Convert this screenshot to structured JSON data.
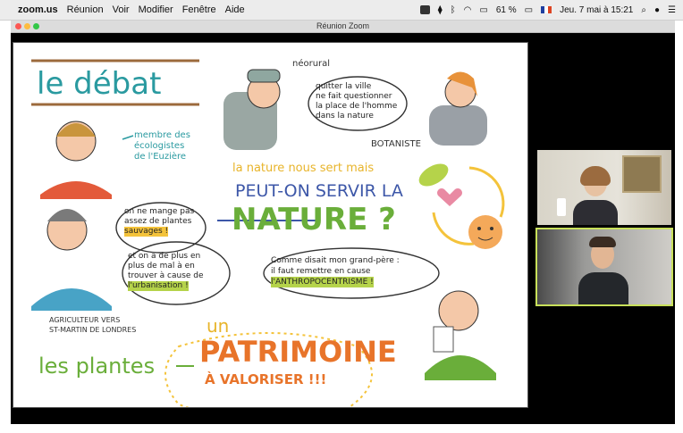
{
  "menubar": {
    "app": "zoom.us",
    "items": [
      "Réunion",
      "Voir",
      "Modifier",
      "Fenêtre",
      "Aide"
    ],
    "battery": "61 %",
    "datetime": "Jeu. 7 mai à 15:21"
  },
  "window": {
    "title": "Réunion Zoom"
  },
  "board": {
    "title": "le débat",
    "neorural_label": "néorural",
    "neorural_quote": [
      "quitter la ville",
      "ne fait questionner",
      "la place de l'homme",
      "dans la nature"
    ],
    "botanist_label": "BOTANISTE",
    "ecologist_caption": [
      "membre des",
      "écologistes",
      "de l'Euzière"
    ],
    "main_line1": "la nature nous sert mais",
    "main_line2": "PEUT-ON SERVIR LA",
    "main_line3": "NATURE ?",
    "farmer_quote1": [
      "on ne mange pas",
      "assez de plantes",
      "sauvages !"
    ],
    "farmer_quote2": [
      "et on a de plus en",
      "plus de mal à en",
      "trouver à cause de",
      "l'urbanisation !"
    ],
    "grandpa_quote": [
      "Comme disait mon grand-père :",
      "il faut remettre en cause",
      "l'ANTHROPOCENTRISME !"
    ],
    "farmer_label": [
      "AGRICULTEUR VERS",
      "ST-MARTIN DE LONDRES"
    ],
    "plants": "les plantes",
    "patrimoine_un": "un",
    "patrimoine": "PATRIMOINE",
    "valoriser": "À VALORISER !!!"
  },
  "colors": {
    "brown": "#9c6a3c",
    "teal": "#2a9aa0",
    "orange": "#e8742a",
    "blue": "#3d57a8",
    "green": "#6aae3a",
    "pink": "#e98aa3",
    "yellow": "#f4c33b"
  }
}
